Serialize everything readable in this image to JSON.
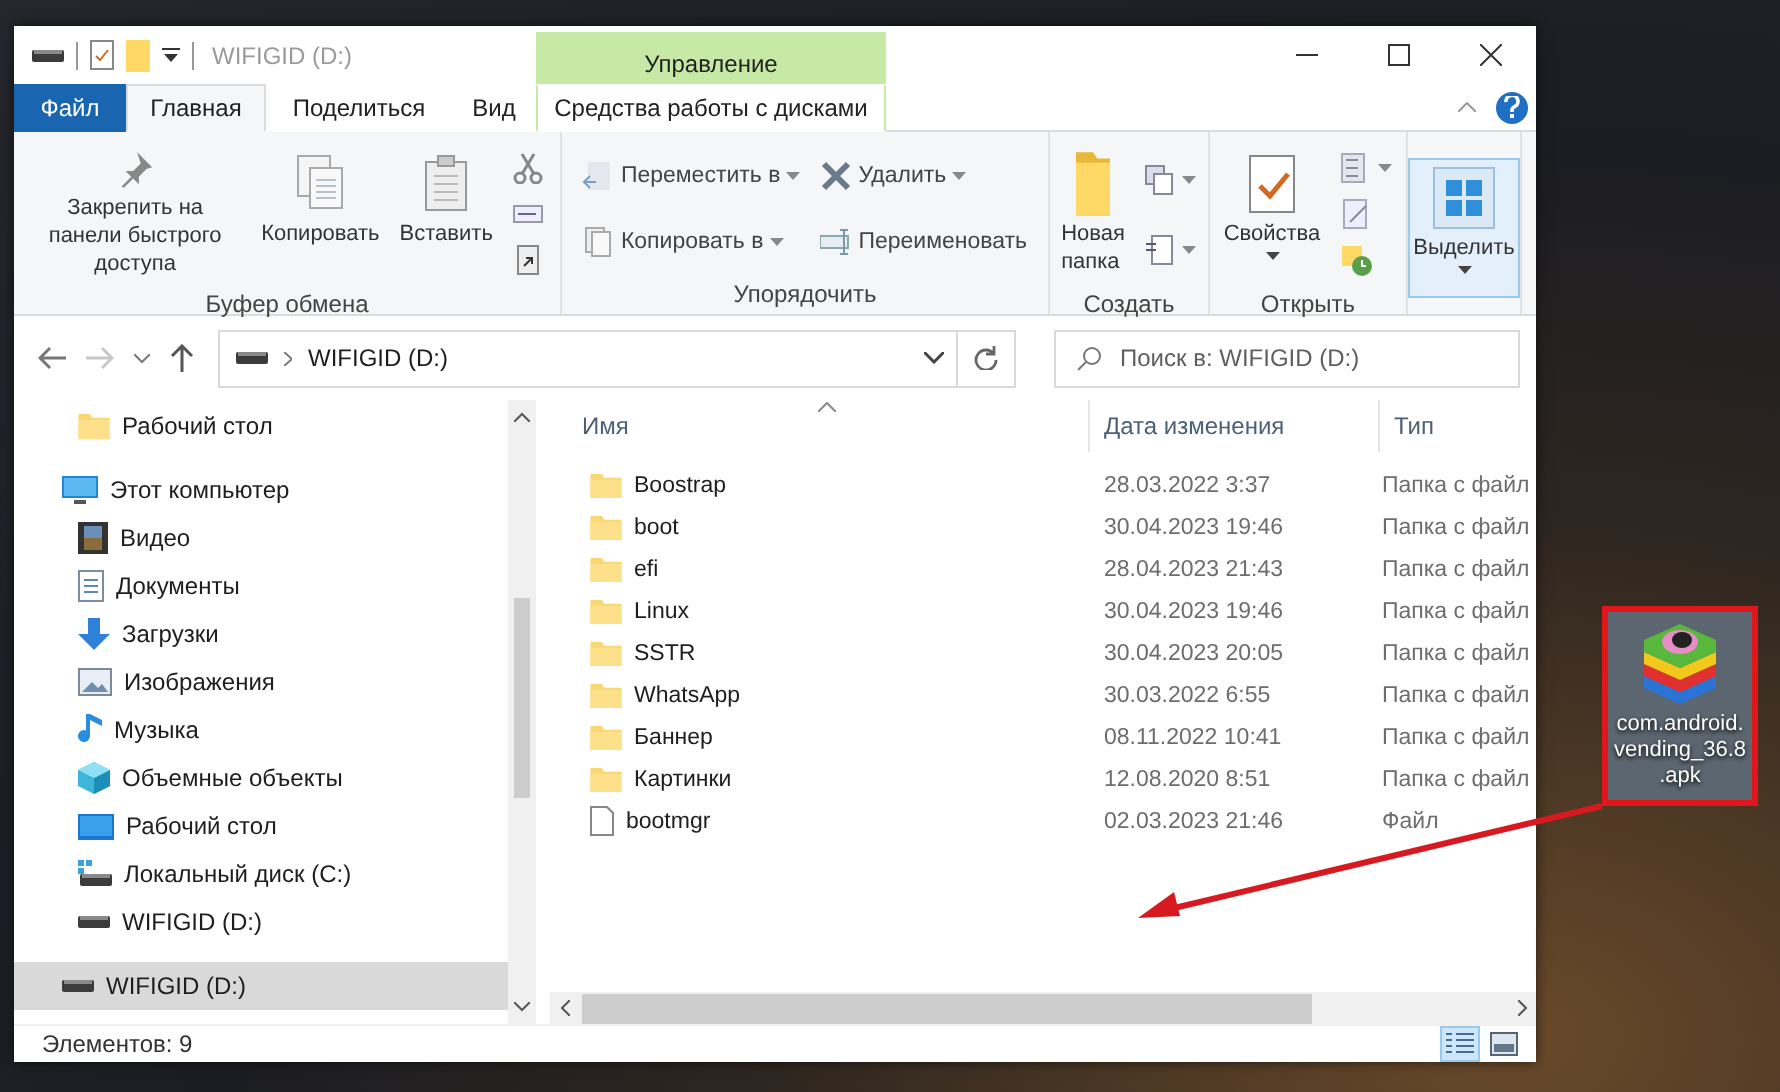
{
  "window": {
    "title": "WIFIGID (D:)",
    "context_header": "Управление"
  },
  "quick_access_toolbar": [
    {
      "kind": "drive"
    },
    {
      "kind": "properties"
    },
    {
      "kind": "new_folder"
    },
    {
      "kind": "customize"
    }
  ],
  "ribbon_tabs": [
    {
      "label": "Файл",
      "kind": "file",
      "selected": false
    },
    {
      "label": "Главная",
      "kind": "tab",
      "selected": true
    },
    {
      "label": "Поделиться",
      "kind": "tab",
      "selected": false
    },
    {
      "label": "Вид",
      "kind": "tab",
      "selected": false
    },
    {
      "label": "Средства работы с дисками",
      "kind": "context",
      "selected": false
    }
  ],
  "ribbon_groups": [
    {
      "label": "Буфер обмена",
      "columns": [
        [
          {
            "kind": "pin",
            "label": "Закрепить на панели быстрого доступа",
            "has_menu": false,
            "highlighted": false
          }
        ],
        [
          {
            "kind": "copy",
            "label": "Копировать",
            "has_menu": false,
            "highlighted": false
          }
        ],
        [
          {
            "kind": "paste",
            "label": "Вставить",
            "has_menu": false,
            "highlighted": false
          }
        ],
        [
          {
            "kind": "cut",
            "has_menu": false,
            "highlighted": false
          },
          {
            "kind": "copy_path",
            "has_menu": false,
            "highlighted": false
          },
          {
            "kind": "paste_shortcut",
            "has_menu": false,
            "highlighted": false
          }
        ]
      ]
    },
    {
      "label": "Упорядочить",
      "columns": [
        [
          {
            "kind": "move_to",
            "label": "Переместить в",
            "has_menu": true,
            "highlighted": false
          },
          {
            "kind": "copy_to",
            "label": "Копировать в",
            "has_menu": true,
            "highlighted": false
          }
        ],
        [
          {
            "kind": "delete",
            "label": "Удалить",
            "has_menu": true,
            "highlighted": false
          },
          {
            "kind": "rename",
            "label": "Переименовать",
            "has_menu": false,
            "highlighted": false
          }
        ]
      ]
    },
    {
      "label": "Создать",
      "columns": [
        [
          {
            "kind": "new_folder",
            "label": "Новая папка",
            "has_menu": false,
            "highlighted": false
          }
        ],
        [
          {
            "kind": "new_item",
            "has_menu": true,
            "highlighted": false
          },
          {
            "kind": "easy_access",
            "has_menu": true,
            "highlighted": false
          }
        ]
      ]
    },
    {
      "label": "Открыть",
      "columns": [
        [
          {
            "kind": "properties",
            "label": "Свойства",
            "has_menu": true,
            "highlighted": false
          }
        ],
        [
          {
            "kind": "open",
            "has_menu": true,
            "highlighted": false
          },
          {
            "kind": "edit",
            "has_menu": false,
            "highlighted": false
          },
          {
            "kind": "history",
            "has_menu": false,
            "highlighted": false
          }
        ]
      ]
    },
    {
      "columns": [
        [
          {
            "kind": "select",
            "label": "Выделить",
            "has_menu": true,
            "highlighted": true
          }
        ]
      ]
    }
  ],
  "address_bar": {
    "path": "WIFIGID (D:)"
  },
  "search": {
    "placeholder": "Поиск в: WIFIGID (D:)"
  },
  "navigation": {
    "quick_access": [
      {
        "label": "Рабочий стол",
        "kind": "folder",
        "selected": false
      }
    ],
    "tree": [
      {
        "label": "Этот компьютер",
        "kind": "this_pc",
        "selected": false,
        "children": [
          {
            "label": "Видео",
            "kind": "video",
            "selected": false
          },
          {
            "label": "Документы",
            "kind": "documents",
            "selected": false
          },
          {
            "label": "Загрузки",
            "kind": "downloads",
            "selected": false
          },
          {
            "label": "Изображения",
            "kind": "pictures",
            "selected": false
          },
          {
            "label": "Музыка",
            "kind": "music",
            "selected": false
          },
          {
            "label": "Объемные объекты",
            "kind": "objects3d",
            "selected": false
          },
          {
            "label": "Рабочий стол",
            "kind": "desktop",
            "selected": false
          },
          {
            "label": "Локальный диск (C:)",
            "kind": "system_disk",
            "selected": false
          },
          {
            "label": "WIFIGID (D:)",
            "kind": "disk",
            "selected": false
          }
        ]
      },
      {
        "label": "WIFIGID (D:)",
        "kind": "disk",
        "selected": true
      }
    ]
  },
  "file_list": {
    "columns": [
      "Имя",
      "Дата изменения",
      "Тип"
    ],
    "rows": [
      {
        "name": "Boostrap",
        "date": "28.03.2022 3:37",
        "type": "Папка с файл",
        "kind": "folder"
      },
      {
        "name": "boot",
        "date": "30.04.2023 19:46",
        "type": "Папка с файл",
        "kind": "folder"
      },
      {
        "name": "efi",
        "date": "28.04.2023 21:43",
        "type": "Папка с файл",
        "kind": "folder"
      },
      {
        "name": "Linux",
        "date": "30.04.2023 19:46",
        "type": "Папка с файл",
        "kind": "folder"
      },
      {
        "name": "SSTR",
        "date": "30.04.2023 20:05",
        "type": "Папка с файл",
        "kind": "folder"
      },
      {
        "name": "WhatsApp",
        "date": "30.03.2022 6:55",
        "type": "Папка с файл",
        "kind": "folder"
      },
      {
        "name": "Баннер",
        "date": "08.11.2022 10:41",
        "type": "Папка с файл",
        "kind": "folder"
      },
      {
        "name": "Картинки",
        "date": "12.08.2020 8:51",
        "type": "Папка с файл",
        "kind": "folder"
      },
      {
        "name": "bootmgr",
        "date": "02.03.2023 21:46",
        "type": "Файл",
        "kind": "file"
      }
    ]
  },
  "status_bar": {
    "item_count": "Элементов: 9",
    "views": [
      {
        "kind": "details",
        "selected": true
      },
      {
        "kind": "large_icons",
        "selected": false
      }
    ]
  },
  "desktop_icon": {
    "label": "com.android.vending_36.8.apk",
    "selected": true
  }
}
